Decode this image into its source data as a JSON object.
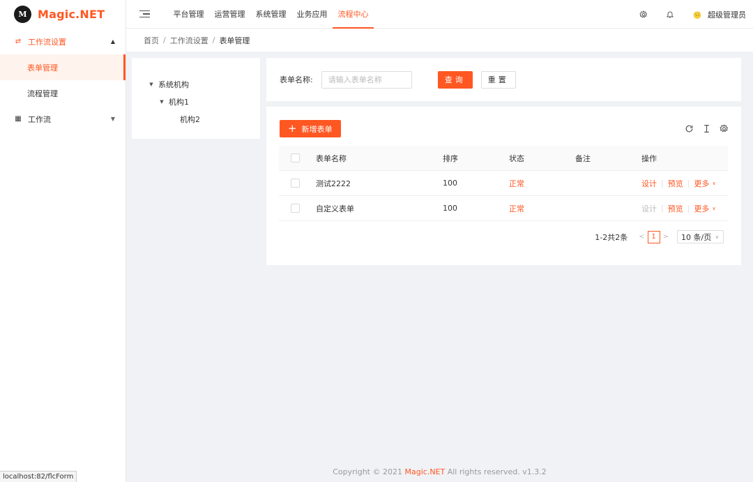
{
  "app": {
    "logo_mark": "M",
    "brand": "Magic.NET"
  },
  "sidebar": {
    "groups": [
      {
        "label": "工作流设置",
        "icon": "swap-icon",
        "expanded": true,
        "children": [
          {
            "label": "表单管理",
            "active": true
          },
          {
            "label": "流程管理",
            "active": false
          }
        ]
      },
      {
        "label": "工作流",
        "icon": "grid-icon",
        "expanded": false
      }
    ]
  },
  "header": {
    "nav": [
      {
        "label": "平台管理"
      },
      {
        "label": "运营管理"
      },
      {
        "label": "系统管理"
      },
      {
        "label": "业务应用"
      },
      {
        "label": "流程中心",
        "active": true
      }
    ],
    "user_name": "超级管理员"
  },
  "breadcrumb": [
    "首页",
    "工作流设置",
    "表单管理"
  ],
  "tree": {
    "nodes": [
      {
        "label": "系统机构"
      },
      {
        "label": "机构1"
      },
      {
        "label": "机构2"
      }
    ]
  },
  "search": {
    "label": "表单名称:",
    "placeholder": "请输入表单名称",
    "value": "",
    "query_btn": "查询",
    "reset_btn": "重置"
  },
  "table": {
    "add_btn": "新增表单",
    "columns": [
      "表单名称",
      "排序",
      "状态",
      "备注",
      "操作"
    ],
    "rows": [
      {
        "name": "测试2222",
        "sort": "100",
        "status": "正常",
        "remark": "",
        "ops": {
          "design": "设计",
          "preview": "预览",
          "more": "更多"
        },
        "design_disabled": false
      },
      {
        "name": "自定义表单",
        "sort": "100",
        "status": "正常",
        "remark": "",
        "ops": {
          "design": "设计",
          "preview": "预览",
          "more": "更多"
        },
        "design_disabled": true
      }
    ]
  },
  "pager": {
    "total_text": "1-2共2条",
    "current": "1",
    "page_size": "10 条/页"
  },
  "footer": {
    "prefix": "Copyright © 2021",
    "brand": "Magic.NET",
    "suffix": "All rights reserved. v1.3.2"
  },
  "status_url": "localhost:82/flcForm",
  "colors": {
    "accent": "#ff5722",
    "accent_light": "#fff3ed"
  }
}
